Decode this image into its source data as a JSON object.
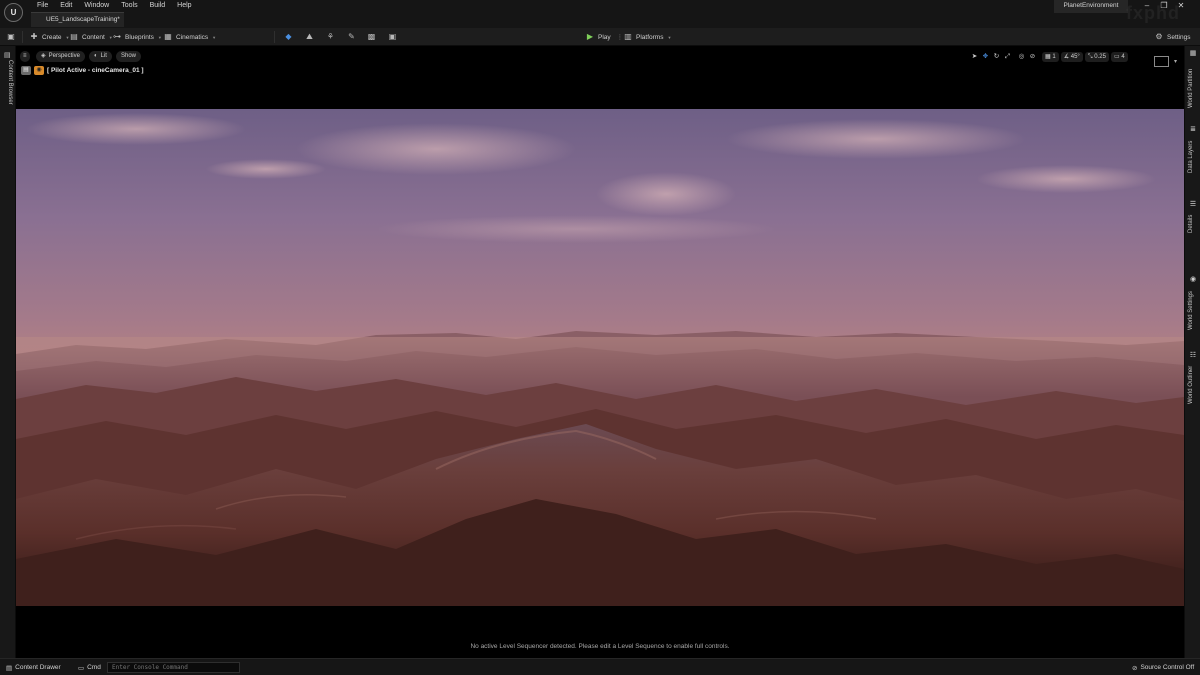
{
  "app": {
    "logo": "U",
    "tab_title": "UE5_LandscapeTraining*",
    "project_name": "PlanetEnvironment",
    "watermark": "fxphd"
  },
  "menu": [
    "File",
    "Edit",
    "Window",
    "Tools",
    "Build",
    "Help"
  ],
  "toolbar": {
    "create": "Create",
    "content": "Content",
    "blueprints": "Blueprints",
    "cinematics": "Cinematics",
    "play": "Play",
    "platforms": "Platforms",
    "settings": "Settings"
  },
  "left_rail": {
    "content_browser": "Content Browser"
  },
  "right_rail": {
    "world_partition": "World Partition",
    "data_layers": "Data Layers",
    "details": "Details",
    "world_settings": "World Settings",
    "world_outliner": "World Outliner"
  },
  "viewport": {
    "perspective": "Perspective",
    "lit": "Lit",
    "show": "Show",
    "pilot_label": "[ Pilot Active - cineCamera_01 ]",
    "angle": "45°",
    "scale": "0.25",
    "grid": "1",
    "camera_speed": "4",
    "sequencer_message": "No active Level Sequencer detected. Please edit a Level Sequence to enable full controls."
  },
  "bottombar": {
    "content_drawer": "Content Drawer",
    "cmd": "Cmd",
    "console_placeholder": "Enter Console Command",
    "source_control": "Source Control Off"
  },
  "colors": {
    "play_green": "#7fcf5a",
    "pilot_orange": "#d88a2a",
    "sky_top": "#7a6a93",
    "sky_horizon": "#c98a7a",
    "terrain_dark": "#3a1e1a"
  }
}
